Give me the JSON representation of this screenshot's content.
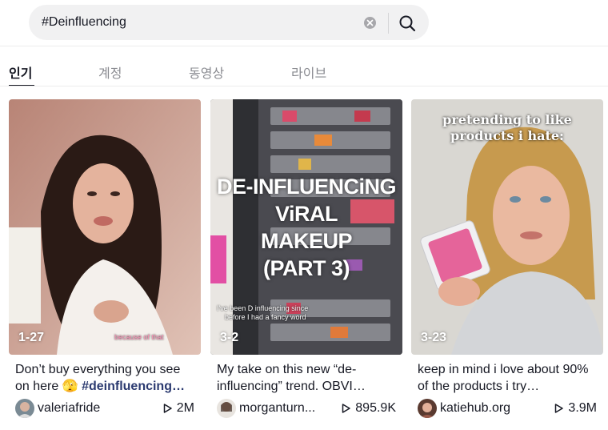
{
  "search": {
    "value": "#Deinfluencing"
  },
  "tabs": [
    {
      "label": "인기",
      "active": true
    },
    {
      "label": "계정",
      "active": false
    },
    {
      "label": "동영상",
      "active": false
    },
    {
      "label": "라이브",
      "active": false
    }
  ],
  "cards": [
    {
      "rank": "1-27",
      "desc_text": "Don’t buy everything you see on here 🫣 ",
      "desc_hashtag": "#deinfluencing…",
      "username": "valeriafride",
      "views": "2M",
      "caption": "because of that"
    },
    {
      "rank": "3-2",
      "desc_text": "My take on this new “de-influencing” trend. OBVI…",
      "username": "morganturn...",
      "views": "895.9K",
      "overlay_lines": [
        "DE-INFLUENCiNG",
        "ViRAL",
        "MAKEUP",
        "(PART 3)"
      ],
      "caption_line1": "I've been D influencing since",
      "caption_line2": "before I had a fancy word"
    },
    {
      "rank": "3-23",
      "desc_text": "keep in mind i love about 90% of the products i try…",
      "username": "katiehub.org",
      "views": "3.9M",
      "overlay_lines": [
        "pretending to like",
        "products i hate:"
      ]
    }
  ],
  "colors": {
    "text": "#161823",
    "muted": "#8a8b91",
    "search_bg": "#f1f1f2",
    "hashtag": "#2b3a70"
  }
}
